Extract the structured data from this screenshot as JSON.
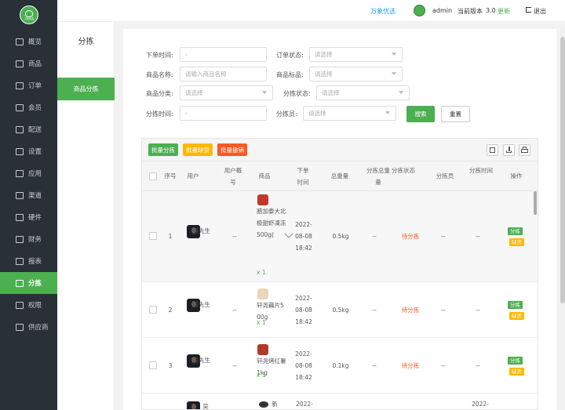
{
  "sidebar": {
    "logo_text": "万象优选",
    "items": [
      {
        "label": "概览",
        "icon": "monitor-icon"
      },
      {
        "label": "商品",
        "icon": "product-box-icon"
      },
      {
        "label": "订单",
        "icon": "order-icon"
      },
      {
        "label": "会员",
        "icon": "users-icon"
      },
      {
        "label": "配送",
        "icon": "truck-icon"
      },
      {
        "label": "设置",
        "icon": "gear-icon"
      },
      {
        "label": "应用",
        "icon": "apps-icon"
      },
      {
        "label": "渠道",
        "icon": "cube-icon"
      },
      {
        "label": "硬件",
        "icon": "monitor-icon"
      },
      {
        "label": "财务",
        "icon": "yen-icon"
      },
      {
        "label": "报表",
        "icon": "bar-chart-icon"
      },
      {
        "label": "分拣",
        "icon": "cloud-icon",
        "active": true
      },
      {
        "label": "权限",
        "icon": "bank-icon"
      },
      {
        "label": "供应商",
        "icon": "user-icon"
      }
    ]
  },
  "topbar": {
    "brand_link": "万象优选",
    "username": "admin",
    "version_label": "当前版本",
    "version": "3.0",
    "update_link": "更新",
    "logout": "退出"
  },
  "subnav": {
    "title": "分拣",
    "item": "商品分拣"
  },
  "filters": {
    "order_time_label": "下单时间:",
    "order_time_value": "-",
    "order_status_label": "订单状态:",
    "order_status_placeholder": "请选择",
    "product_name_label": "商品名称:",
    "product_name_placeholder": "请输入商品名称",
    "product_tag_label": "商品标品:",
    "product_tag_placeholder": "请选择",
    "product_category_label": "商品分类:",
    "product_category_placeholder": "请选择",
    "sort_status_label": "分拣状态:",
    "sort_status_placeholder": "请选择",
    "sort_time_label": "分拣时间:",
    "sort_time_value": "-",
    "sorter_label": "分拣员:",
    "sorter_placeholder": "请选择",
    "search_button": "搜索",
    "reset_button": "重置"
  },
  "toolbar": {
    "batch_sort": "批量分拣",
    "batch_shortage": "批量缺货",
    "batch_cancel": "批量撤销",
    "colors": {
      "sort": "#4caf50",
      "shortage": "#ffb800",
      "cancel": "#ff5722"
    }
  },
  "table": {
    "headers": [
      "序号",
      "用户",
      "用户概号",
      "商品",
      "下单时间",
      "总重量",
      "分拣总重量",
      "分拣状态",
      "分拣员",
      "分拣时间",
      "操作"
    ],
    "rows": [
      {
        "index": "1",
        "user": "吴先生",
        "user_no": "--",
        "product": "腊加泰大北极甜虾凍冻500g(",
        "qty": "x 1",
        "order_time": "2022-08-08 18:42",
        "weight": "0.5kg",
        "sort_weight": "--",
        "status": "待分拣",
        "sorter": "--",
        "sort_time": "--",
        "img_color": "#c0392b"
      },
      {
        "index": "2",
        "user": "吴先生",
        "user_no": "--",
        "product": "轩尧藕片500g",
        "qty": "x 1",
        "order_time": "2022-08-08 18:42",
        "weight": "0.5kg",
        "sort_weight": "--",
        "status": "待分拣",
        "sorter": "--",
        "sort_time": "--",
        "img_color": "#e8d7b8"
      },
      {
        "index": "3",
        "user": "吴先生",
        "user_no": "--",
        "product": "轩尧烤红薯1kg",
        "qty": "x 1",
        "order_time": "2022-08-08 18:42",
        "weight": "0.1kg",
        "sort_weight": "--",
        "status": "待分拣",
        "sorter": "--",
        "sort_time": "--",
        "img_color": "#b0392a"
      },
      {
        "index": "",
        "user": "吴",
        "user_no": "",
        "product": "新",
        "qty": "",
        "order_time": "2022-",
        "weight": "",
        "sort_weight": "",
        "status": "",
        "sorter": "",
        "sort_time": "2022-",
        "img_color": "#333333"
      }
    ],
    "action_sort": "分拣",
    "action_shortage": "缺货"
  }
}
